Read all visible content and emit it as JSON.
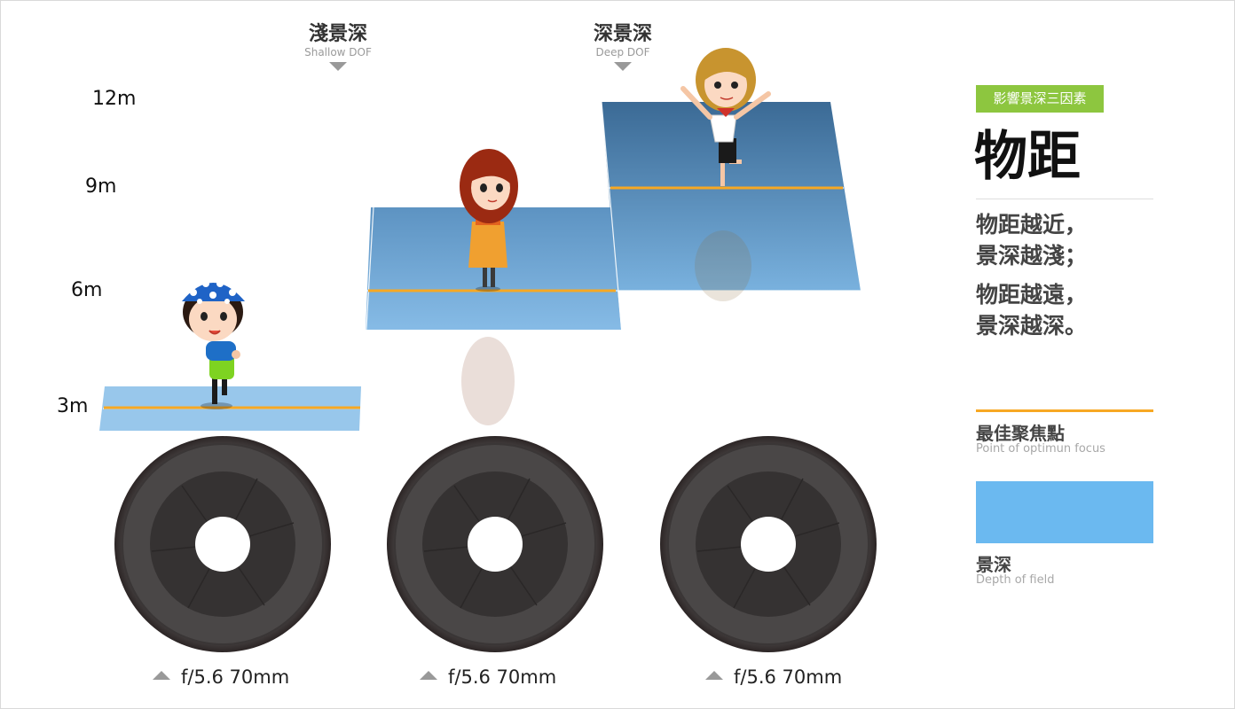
{
  "headers": {
    "shallow": {
      "zh": "淺景深",
      "en": "Shallow DOF"
    },
    "deep": {
      "zh": "深景深",
      "en": "Deep DOF"
    }
  },
  "distance_labels": [
    "12m",
    "9m",
    "6m",
    "3m"
  ],
  "lenses": [
    {
      "label": "f/5.6 70mm"
    },
    {
      "label": "f/5.6 70mm"
    },
    {
      "label": "f/5.6 70mm"
    }
  ],
  "panel": {
    "badge": "影響景深三因素",
    "title": "物距",
    "desc": [
      "物距越近，",
      "景深越淺；",
      "物距越遠，",
      "景深越深。"
    ],
    "legend": {
      "focus_zh": "最佳聚焦點",
      "focus_en": "Point of optimun focus",
      "dof_zh": "景深",
      "dof_en": "Depth of field"
    }
  },
  "colors": {
    "focus_line": "#f7a823",
    "dof_band": "#6bb9f0",
    "badge": "#8dc63f"
  },
  "characters": [
    "girl-polka-dot-hat",
    "girl-red-hair-coat",
    "girl-blonde-waving"
  ]
}
